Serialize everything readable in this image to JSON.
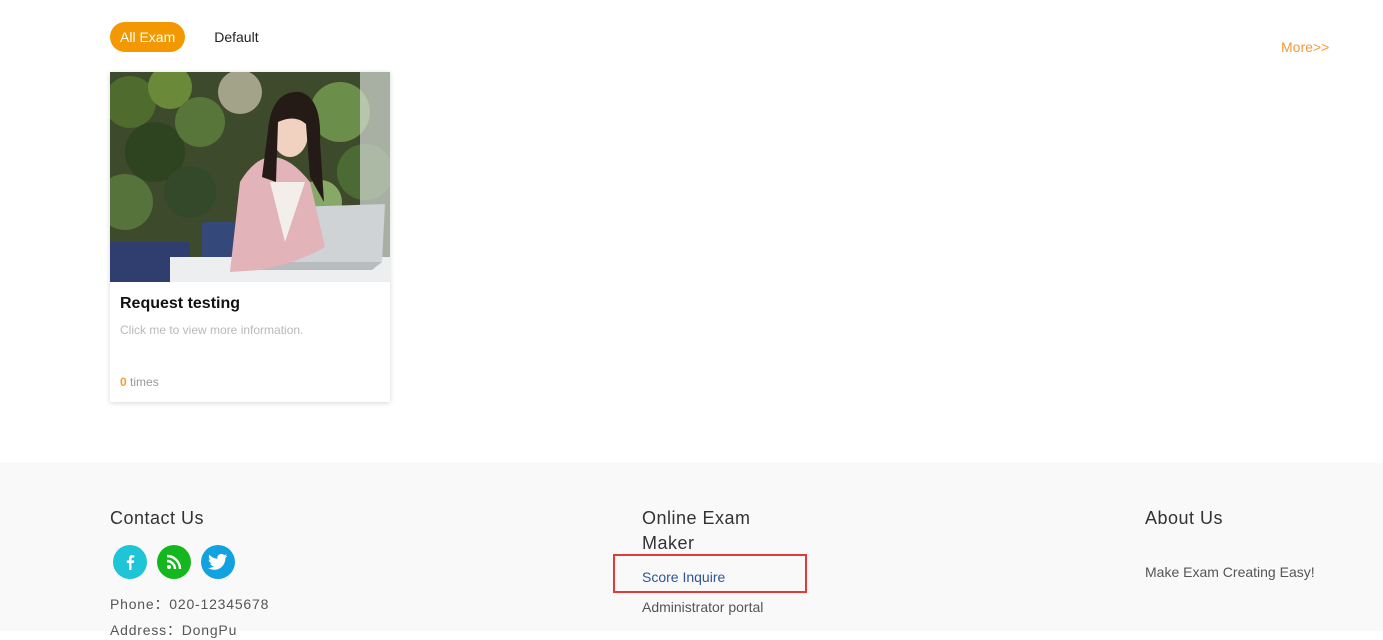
{
  "filters": {
    "active_label": "All Exam",
    "default_label": "Default"
  },
  "more_link": "More>>",
  "exam_card": {
    "photo_icon": "woman-on-phone-at-laptop-photo",
    "title": "Request testing",
    "description": "Click me to view more information.",
    "count": "0",
    "count_suffix": " times"
  },
  "footer": {
    "contact": {
      "heading": "Contact Us",
      "social": [
        {
          "icon": "facebook-icon",
          "color": "#1fc4d6"
        },
        {
          "icon": "rss-icon",
          "color": "#14b81e"
        },
        {
          "icon": "twitter-icon",
          "color": "#12a2e0"
        }
      ],
      "phone": "Phone：020-12345678",
      "address": "Address：DongPu"
    },
    "maker": {
      "heading_line1": "Online Exam",
      "heading_line2": "Maker",
      "links": [
        "Score Inquire",
        "Administrator portal"
      ]
    },
    "about": {
      "heading": "About Us",
      "text": "Make Exam Creating Easy!"
    }
  },
  "colors": {
    "accent": "#f39800",
    "link": "#2e5597",
    "highlight": "#e53935"
  }
}
